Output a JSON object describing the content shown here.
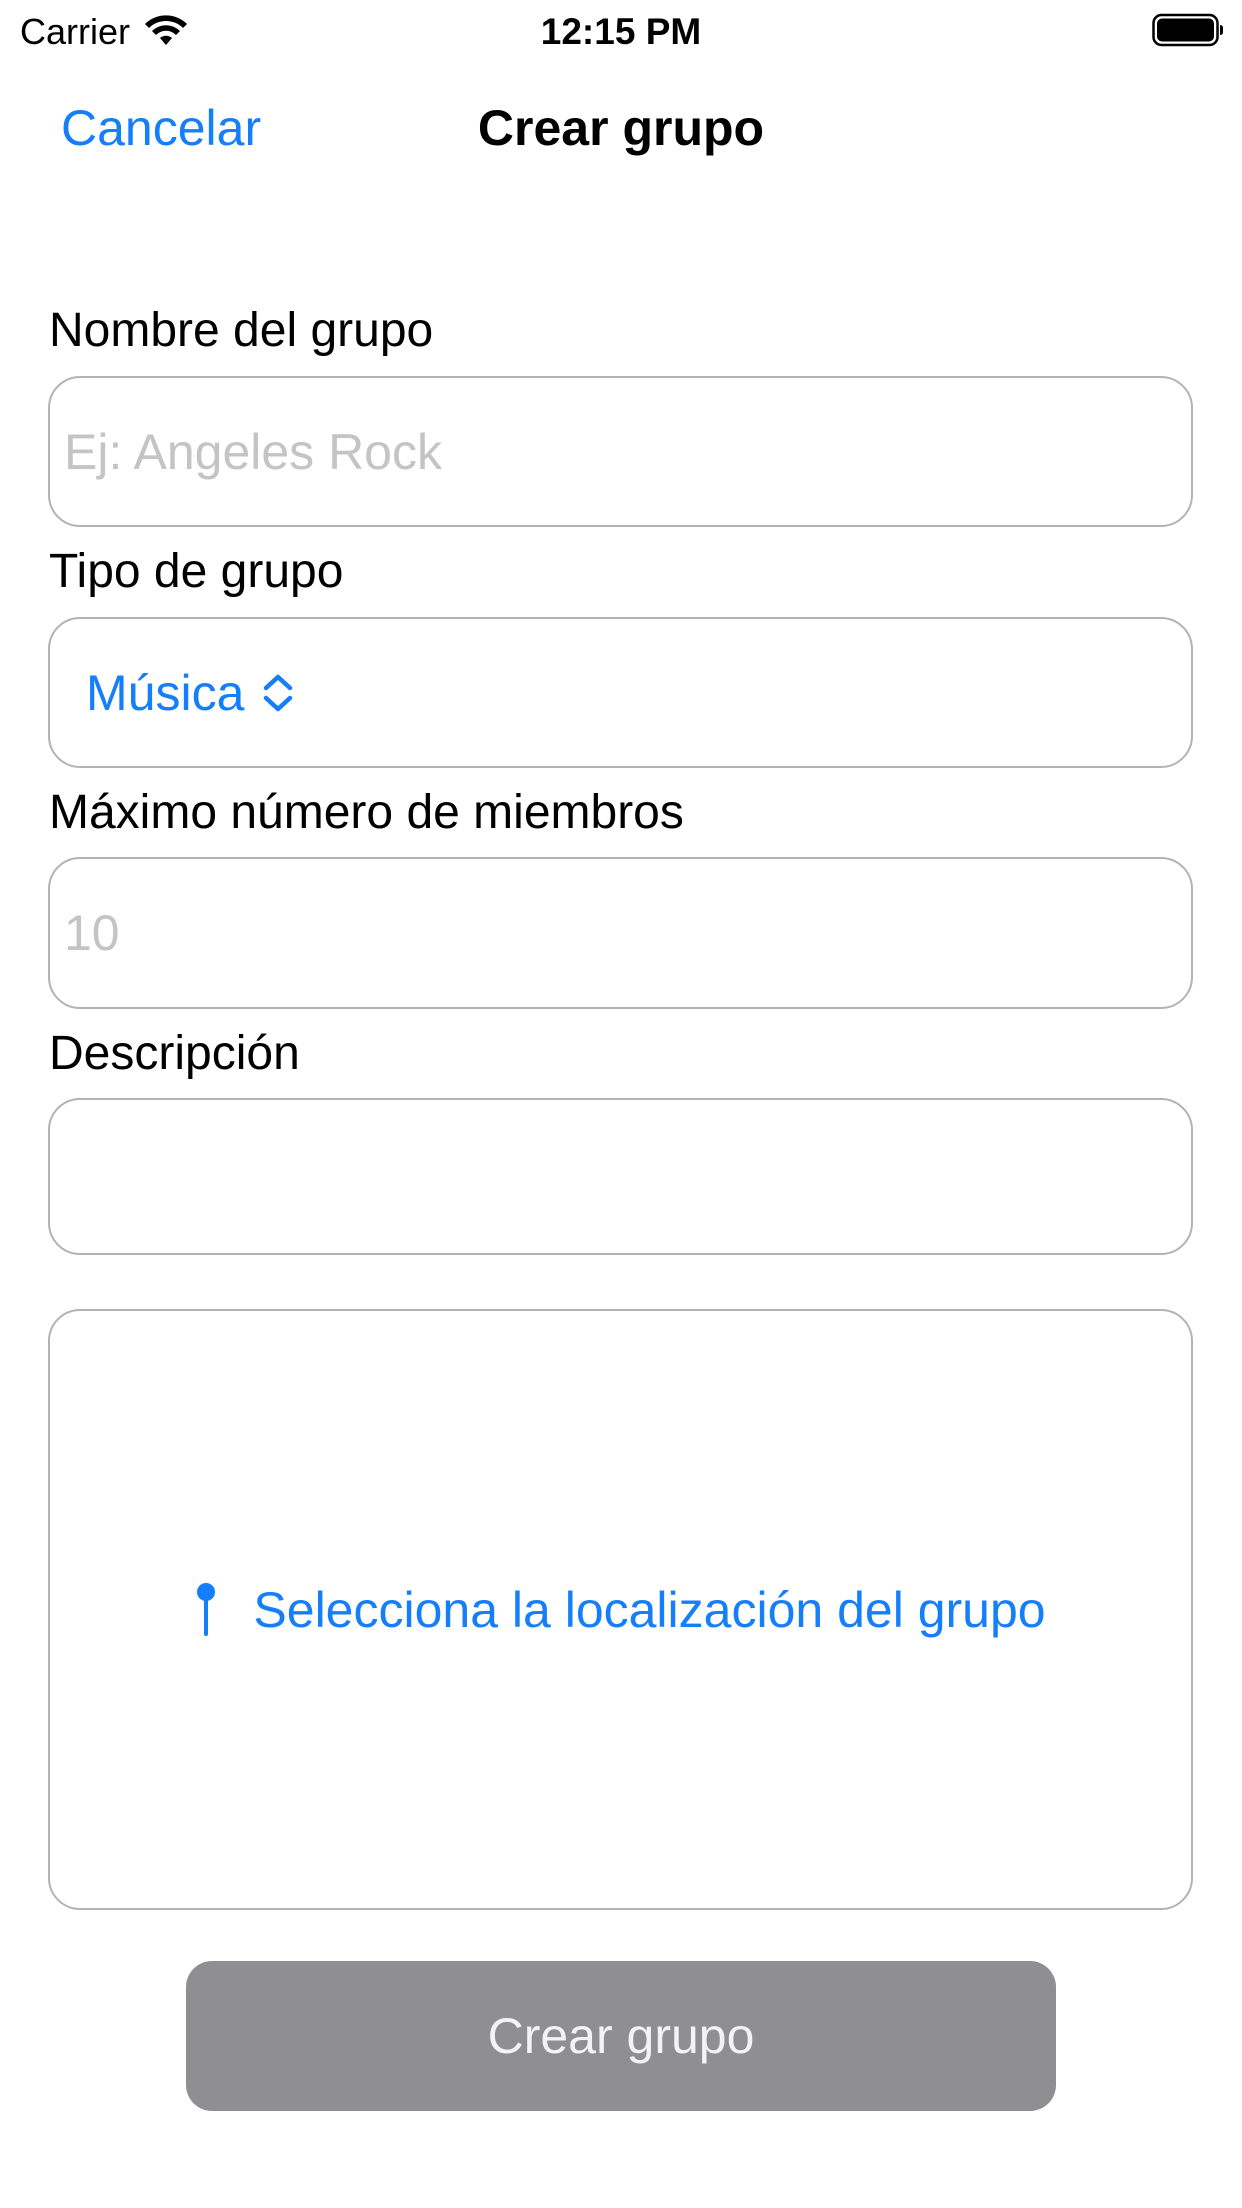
{
  "status_bar": {
    "carrier": "Carrier",
    "time": "12:15 PM",
    "wifi_icon": "wifi-icon",
    "battery_icon": "battery-icon"
  },
  "nav": {
    "cancel_label": "Cancelar",
    "title": "Crear grupo"
  },
  "form": {
    "name_label": "Nombre del grupo",
    "name_placeholder": "Ej: Angeles Rock",
    "name_value": "",
    "type_label": "Tipo de grupo",
    "type_selected": "Música",
    "type_icon": "chevron-up-down-icon",
    "max_members_label": "Máximo número de miembros",
    "max_members_placeholder": "10",
    "max_members_value": "",
    "description_label": "Descripción",
    "description_value": "",
    "location_label": "Selecciona la localización del grupo",
    "location_icon": "map-pin-icon"
  },
  "actions": {
    "create_label": "Crear grupo"
  },
  "colors": {
    "accent": "#147EFB",
    "button_disabled": "#8e8e93",
    "border": "#b3b3b7",
    "placeholder": "#c4c4c6"
  }
}
